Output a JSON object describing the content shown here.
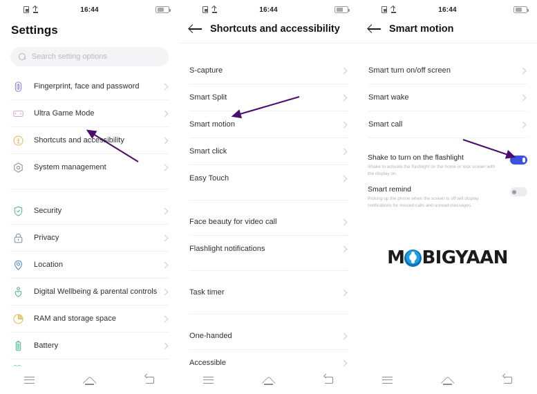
{
  "status_bar": {
    "time": "16:44",
    "left_icons": [
      "screenshot-icon",
      "upload-icon"
    ],
    "right_icon": "battery-icon"
  },
  "navbar": {
    "recent_label": "recent-apps",
    "home_label": "home",
    "back_label": "back"
  },
  "panel1": {
    "title": "Settings",
    "search": {
      "placeholder": "Search setting options"
    },
    "groups": [
      {
        "items": [
          {
            "label": "Fingerprint, face and password",
            "icon": "fingerprint-icon"
          },
          {
            "label": "Ultra Game Mode",
            "icon": "gamepad-icon"
          },
          {
            "label": "Shortcuts and accessibility",
            "icon": "accessibility-icon"
          },
          {
            "label": "System management",
            "icon": "gear-hex-icon"
          }
        ]
      },
      {
        "items": [
          {
            "label": "Security",
            "icon": "shield-check-icon"
          },
          {
            "label": "Privacy",
            "icon": "lock-icon"
          },
          {
            "label": "Location",
            "icon": "location-pin-icon"
          },
          {
            "label": "Digital Wellbeing & parental controls",
            "icon": "wellbeing-icon"
          },
          {
            "label": "RAM and storage space",
            "icon": "pie-storage-icon"
          },
          {
            "label": "Battery",
            "icon": "battery-vertical-icon"
          }
        ]
      }
    ]
  },
  "panel2": {
    "title": "Shortcuts and accessibility",
    "back": "back-arrow",
    "groups": [
      {
        "items": [
          {
            "label": "S-capture"
          },
          {
            "label": "Smart Split"
          },
          {
            "label": "Smart motion"
          },
          {
            "label": "Smart click"
          },
          {
            "label": "Easy Touch"
          }
        ]
      },
      {
        "items": [
          {
            "label": "Face beauty for video call"
          },
          {
            "label": "Flashlight notifications"
          }
        ]
      },
      {
        "items": [
          {
            "label": "Task timer"
          }
        ]
      },
      {
        "items": [
          {
            "label": "One-handed"
          },
          {
            "label": "Accessible"
          }
        ]
      }
    ]
  },
  "panel3": {
    "title": "Smart motion",
    "back": "back-arrow",
    "items": [
      {
        "label": "Smart turn on/off screen"
      },
      {
        "label": "Smart wake"
      },
      {
        "label": "Smart call"
      }
    ],
    "toggles": [
      {
        "title": "Shake to turn on the flashlight",
        "subtitle": "Shake to activate the flashlight on the home or lock screen with the display on.",
        "state": "on"
      },
      {
        "title": "Smart remind",
        "subtitle": "Picking up the phone when the screen is off will display notifications for missed calls and unread messages.",
        "state": "off"
      }
    ],
    "watermark": {
      "text_before": "M",
      "logo_letter": "O",
      "text_after": "BIGYAAN"
    }
  },
  "colors": {
    "accent_toggle_on": "#3b52e0",
    "annotation_arrow": "#4a0d6e",
    "logo_blue": "#1d9fe3"
  }
}
